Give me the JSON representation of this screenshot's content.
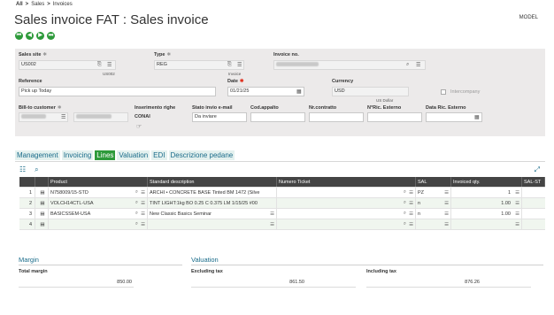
{
  "breadcrumb": {
    "all": "All",
    "sales": "Sales",
    "invoices": "Invoices",
    "sep": ">"
  },
  "page_title": "Sales invoice FAT : Sales invoice",
  "model_label": "MODEL",
  "nav_glyphs": {
    "first": "⏮",
    "prev": "◀",
    "next": "▶",
    "last": "⏭"
  },
  "header": {
    "sales_site": {
      "label": "Sales site",
      "value": "US002",
      "sub": "US002"
    },
    "type": {
      "label": "Type",
      "value": "REG",
      "sub": "Invoice"
    },
    "invoice_no": {
      "label": "Invoice no."
    },
    "reference": {
      "label": "Reference",
      "value": "Pick up Today"
    },
    "date": {
      "label": "Date",
      "value": "01/21/25"
    },
    "currency": {
      "label": "Currency",
      "value": "USD",
      "sub": "US Dollar"
    },
    "intercompany": {
      "label": "Intercompany"
    },
    "bill_to": {
      "label": "Bill-to customer"
    },
    "inserimento_righe": {
      "label": "Inserimento righe",
      "value": "CONAI"
    },
    "stato_invio": {
      "label": "Stato invio e-mail",
      "value": "Da inviare"
    },
    "cod_appalto": {
      "label": "Cod.appalto"
    },
    "nr_contratto": {
      "label": "Nr.contratto"
    },
    "nric_esterno": {
      "label": "N°Ric. Esterno"
    },
    "data_ric_esterno": {
      "label": "Data Ric. Esterno"
    }
  },
  "tabs": [
    "Management",
    "Invoicing",
    "Lines",
    "Valuation",
    "EDI",
    "Descrizione pedane"
  ],
  "active_tab": "Lines",
  "grid": {
    "columns": [
      "",
      "",
      "Product",
      "Standard description",
      "Numero Ticket",
      "SAL",
      "Invoiced qty.",
      "SAL-ST"
    ],
    "rows": [
      {
        "n": "1",
        "product": "N758009/15-STD",
        "desc": "ARCHI • CONCRETE BASE Tinted BM 1472 (Silve",
        "ticket": "",
        "sal": "PZ",
        "qty": "1"
      },
      {
        "n": "2",
        "product": "VOLCH14CTL-USA",
        "desc": "TINT LIGHT:1kg BO 0.25 C 0.375 LM 1/15/25 #00",
        "ticket": "",
        "sal": "n",
        "qty": "1.00"
      },
      {
        "n": "3",
        "product": "BASICSSEM-USA",
        "desc": "New Classic Basics Seminar",
        "ticket": "",
        "sal": "n",
        "qty": "1.00"
      },
      {
        "n": "4",
        "product": "",
        "desc": "",
        "ticket": "",
        "sal": "",
        "qty": ""
      }
    ]
  },
  "margin": {
    "title": "Margin",
    "total_label": "Total margin",
    "total_value": "850.00"
  },
  "valuation": {
    "title": "Valuation",
    "excl_label": "Excluding tax",
    "excl_value": "861.50",
    "incl_label": "Including tax",
    "incl_value": "876.26"
  }
}
